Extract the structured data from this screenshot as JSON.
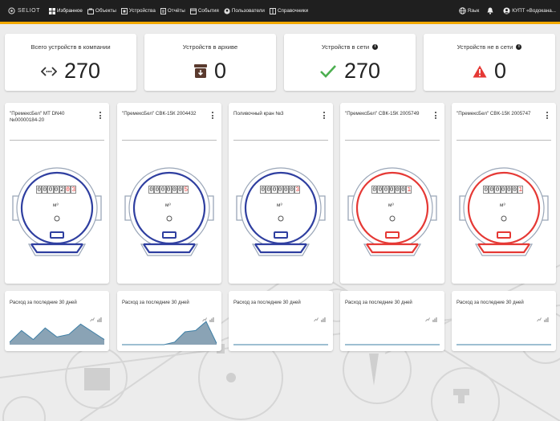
{
  "brand": {
    "name": "SELIOT"
  },
  "nav": {
    "items": [
      {
        "label": "Избранное",
        "icon": "dashboard-icon"
      },
      {
        "label": "Объекты",
        "icon": "objects-icon"
      },
      {
        "label": "Устройства",
        "icon": "devices-icon"
      },
      {
        "label": "Отчёты",
        "icon": "reports-icon"
      },
      {
        "label": "События",
        "icon": "events-icon"
      },
      {
        "label": "Пользователи",
        "icon": "users-icon"
      },
      {
        "label": "Справочники",
        "icon": "reference-icon"
      }
    ],
    "language": "Язык",
    "account": "КУПТ «Водоканa..."
  },
  "stats": [
    {
      "title": "Всего устройств в компании",
      "value": "270",
      "icon": "connection-icon",
      "icon_color": "#333333",
      "info": false
    },
    {
      "title": "Устройств в архиве",
      "value": "0",
      "icon": "archive-icon",
      "icon_color": "#5a3a2e",
      "info": false
    },
    {
      "title": "Устройств в сети",
      "value": "270",
      "icon": "checkmark-icon",
      "icon_color": "#4caf50",
      "info": true
    },
    {
      "title": "Устройств не в сети",
      "value": "0",
      "icon": "warning-icon",
      "icon_color": "#e53935",
      "info": true
    }
  ],
  "devices": [
    {
      "title": "\"ПремексБел\" МТ DN40 №00000184-20",
      "digits": [
        "0",
        "0",
        "0",
        "0",
        "2",
        "0",
        "3"
      ],
      "red_from": 5,
      "unit": "м³",
      "status_color": "#2f3fa0"
    },
    {
      "title": "\"ПремексБел\" СВК-15К 2004432",
      "digits": [
        "0",
        "0",
        "0",
        "0",
        "0",
        "0",
        "5"
      ],
      "red_from": 6,
      "unit": "м³",
      "status_color": "#2f3fa0"
    },
    {
      "title": "Поливочный кран №3",
      "digits": [
        "0",
        "0",
        "0",
        "0",
        "0",
        "0",
        "3"
      ],
      "red_from": 6,
      "unit": "м³",
      "status_color": "#2f3fa0"
    },
    {
      "title": "\"ПремексБел\" СВК-15К 2005749",
      "digits": [
        "0",
        "0",
        "0",
        "0",
        "0",
        "0",
        "1"
      ],
      "red_from": 6,
      "unit": "м³",
      "status_color": "#e53935"
    },
    {
      "title": "\"ПремексБел\" СВК-15К 2005747",
      "digits": [
        "0",
        "0",
        "0",
        "0",
        "0",
        "0",
        "1"
      ],
      "red_from": 6,
      "unit": "м³",
      "status_color": "#e53935"
    }
  ],
  "graphs": [
    {
      "title": "Расход за последние 30 дней",
      "values": [
        0.1,
        0.55,
        0.2,
        0.65,
        0.3,
        0.4,
        0.8,
        0.5,
        0.2
      ]
    },
    {
      "title": "Расход за последние 30 дней",
      "values": [
        0,
        0,
        0,
        0,
        0,
        0.1,
        0.5,
        0.55,
        0.9,
        0.05
      ]
    },
    {
      "title": "Расход за последние 30 дней",
      "values": [
        0,
        0,
        0,
        0,
        0,
        0,
        0,
        0,
        0
      ]
    },
    {
      "title": "Расход за последние 30 дней",
      "values": [
        0,
        0,
        0,
        0,
        0,
        0,
        0,
        0,
        0
      ]
    },
    {
      "title": "Расход за последние 30 дней",
      "values": [
        0,
        0,
        0,
        0,
        0,
        0,
        0,
        0,
        0
      ]
    }
  ],
  "colors": {
    "accent": "#f2a900",
    "topbar": "#1f1f1f",
    "graph_fill": "#8aa3b5",
    "graph_line": "#3d7fa6"
  }
}
